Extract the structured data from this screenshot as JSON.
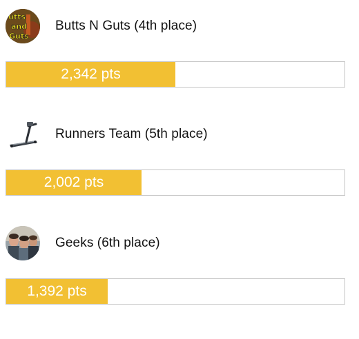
{
  "accent_color": "#f2c033",
  "teams": [
    {
      "avatar_icon": "butts-n-guts-logo-icon",
      "name": "Butts N Guts (4th place)",
      "points_label": "2,342 pts",
      "points": 2342,
      "progress_fraction": 0.5
    },
    {
      "avatar_icon": "treadmill-icon",
      "name": "Runners Team (5th place)",
      "points_label": "2,002 pts",
      "points": 2002,
      "progress_fraction": 0.4
    },
    {
      "avatar_icon": "group-photo-icon",
      "name": "Geeks (6th place)",
      "points_label": "1,392 pts",
      "points": 1392,
      "progress_fraction": 0.3
    }
  ]
}
